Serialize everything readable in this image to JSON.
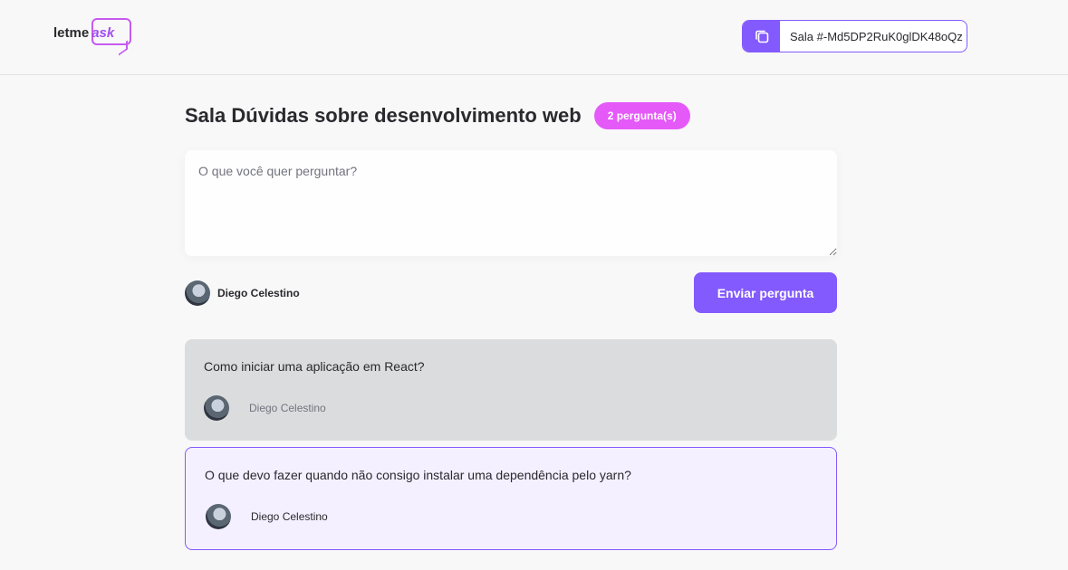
{
  "header": {
    "logo": {
      "main": "letme",
      "accent": "ask"
    },
    "room_code_label": "Sala #-Md5DP2RuK0glDK48oQz",
    "copy_icon": "copy-icon"
  },
  "room": {
    "title": "Sala Dúvidas sobre desenvolvimento web",
    "question_count": "2 pergunta(s)"
  },
  "form": {
    "placeholder": "O que você quer perguntar?",
    "value": "",
    "user_name": "Diego Celestino",
    "submit_label": "Enviar pergunta"
  },
  "questions": [
    {
      "content": "Como iniciar uma aplicação em React?",
      "author": "Diego Celestino",
      "state": "answered"
    },
    {
      "content": "O que devo fazer quando não consigo instalar uma dependência pelo yarn?",
      "author": "Diego Celestino",
      "state": "highlighted"
    }
  ],
  "colors": {
    "accent": "#835afd",
    "badge": "#e559f9",
    "answered_bg": "#dbdcdd",
    "highlighted_bg": "#f4f0ff"
  }
}
